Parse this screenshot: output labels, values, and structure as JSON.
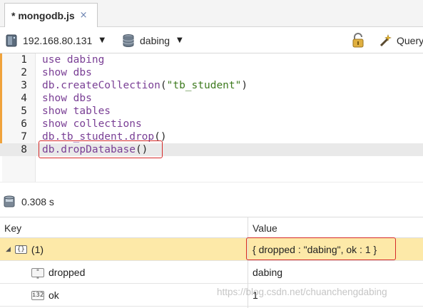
{
  "tab": {
    "label": "* mongodb.js",
    "close": "×"
  },
  "toolbar": {
    "connection": "192.168.80.131",
    "database": "dabing",
    "query_label": "Query"
  },
  "editor": {
    "lines": [
      {
        "num": "1",
        "parts": [
          [
            "kw",
            "use dabing"
          ]
        ]
      },
      {
        "num": "2",
        "parts": [
          [
            "kw",
            "show dbs"
          ]
        ]
      },
      {
        "num": "3",
        "parts": [
          [
            "kw",
            "db.createCollection"
          ],
          [
            "punc",
            "("
          ],
          [
            "str",
            "\"tb_student\""
          ],
          [
            "punc",
            ")"
          ]
        ]
      },
      {
        "num": "4",
        "parts": [
          [
            "kw",
            "show dbs"
          ]
        ]
      },
      {
        "num": "5",
        "parts": [
          [
            "kw",
            "show tables"
          ]
        ]
      },
      {
        "num": "6",
        "parts": [
          [
            "kw",
            "show collections"
          ]
        ]
      },
      {
        "num": "7",
        "parts": [
          [
            "kw",
            "db.tb_student.drop"
          ],
          [
            "punc",
            "()"
          ]
        ]
      },
      {
        "num": "8",
        "parts": [
          [
            "kw",
            "db.dropDatabase"
          ],
          [
            "punc",
            "()"
          ]
        ]
      }
    ]
  },
  "status": {
    "elapsed": "0.308 s"
  },
  "results": {
    "headers": {
      "key": "Key",
      "value": "Value"
    },
    "rows": [
      {
        "key": "(1)",
        "value": "{ dropped : \"dabing\", ok : 1 }",
        "icon": "object-icon"
      },
      {
        "key": "dropped",
        "value": "dabing",
        "icon": "string-type-icon",
        "icon_text": "\" \""
      },
      {
        "key": "ok",
        "value": "1",
        "icon": "int32-type-icon",
        "icon_text": "i32"
      }
    ]
  },
  "watermark": "https://blog.csdn.net/chuanchengdabing"
}
